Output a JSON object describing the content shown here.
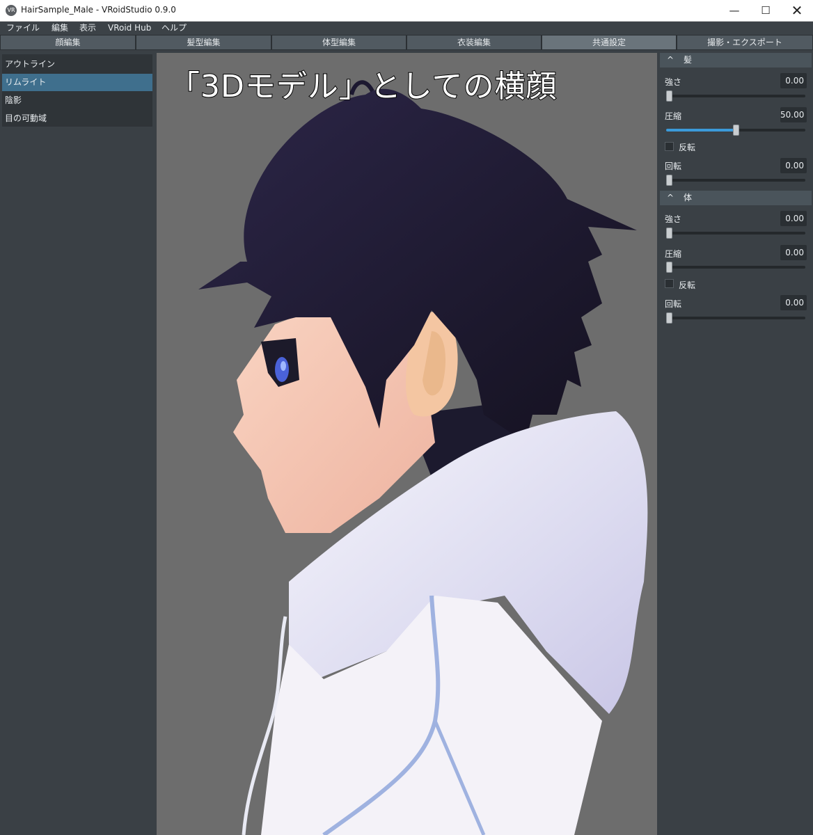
{
  "window": {
    "title": "HairSample_Male - VRoidStudio 0.9.0",
    "icon_text": "VR",
    "minimize_glyph": "—",
    "maximize_glyph": "☐",
    "close_glyph": "✕"
  },
  "menu": [
    "ファイル",
    "編集",
    "表示",
    "VRoid Hub",
    "ヘルプ"
  ],
  "tabs": [
    "顔編集",
    "髪型編集",
    "体型編集",
    "衣装編集",
    "共通設定",
    "撮影・エクスポート"
  ],
  "active_tab": "共通設定",
  "left_list": {
    "items": [
      "アウトライン",
      "リムライト",
      "陰影",
      "目の可動域"
    ],
    "selected": "リムライト"
  },
  "viewport": {
    "caption": "「3Dモデル」としての横顔"
  },
  "right_panel": {
    "sections": [
      {
        "title": "髪",
        "strength_label": "強さ",
        "strength_value": "0.00",
        "strength_fraction": 0.0,
        "compress_label": "圧縮",
        "compress_value": "50.00",
        "compress_fraction": 0.5,
        "invert_label": "反転",
        "invert_checked": false,
        "rotate_label": "回転",
        "rotate_value": "0.00",
        "rotate_fraction": 0.0
      },
      {
        "title": "体",
        "strength_label": "強さ",
        "strength_value": "0.00",
        "strength_fraction": 0.0,
        "compress_label": "圧縮",
        "compress_value": "0.00",
        "compress_fraction": 0.0,
        "invert_label": "反転",
        "invert_checked": false,
        "rotate_label": "回転",
        "rotate_value": "0.00",
        "rotate_fraction": 0.0
      }
    ],
    "chevron_icon": "chevron-up-icon"
  },
  "colors": {
    "accent": "#3b9ad9",
    "selected_item": "#3f6f8d",
    "hair": "#1e1a33",
    "skin": "#f6c9b6",
    "hoodie": "#eceaf6",
    "viewport_bg": "#6d6d6d"
  }
}
